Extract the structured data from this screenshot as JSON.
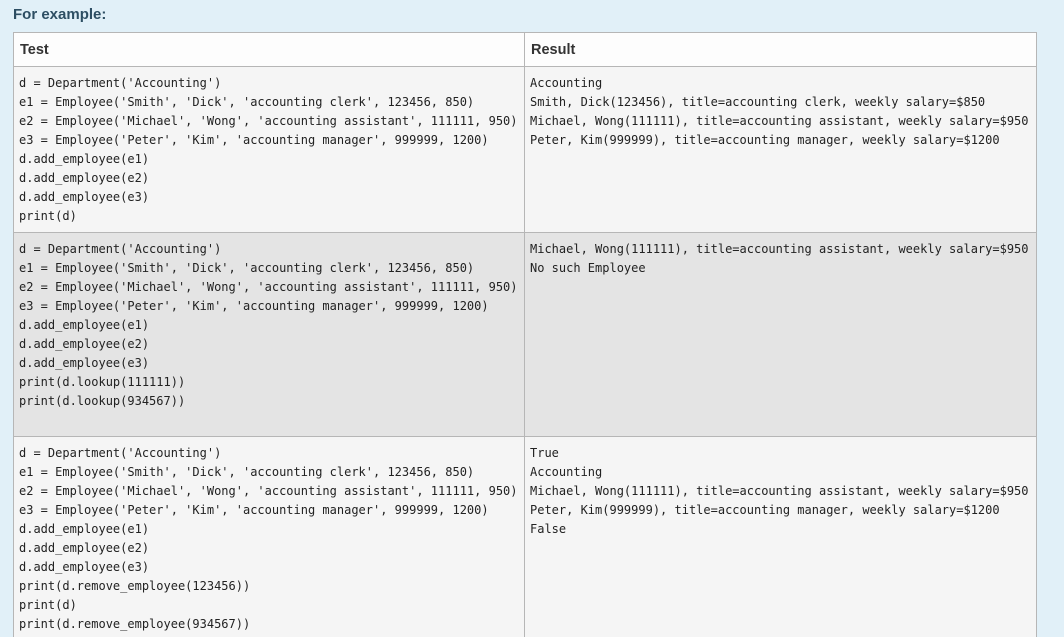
{
  "heading": "For example:",
  "table": {
    "headers": {
      "test": "Test",
      "result": "Result"
    },
    "rows": [
      {
        "test": [
          "d = Department('Accounting')",
          "e1 = Employee('Smith', 'Dick', 'accounting clerk', 123456, 850)",
          "e2 = Employee('Michael', 'Wong', 'accounting assistant', 111111, 950)",
          "e3 = Employee('Peter', 'Kim', 'accounting manager', 999999, 1200)",
          "d.add_employee(e1)",
          "d.add_employee(e2)",
          "d.add_employee(e3)",
          "print(d)"
        ],
        "result": [
          "Accounting",
          "Smith, Dick(123456), title=accounting clerk, weekly salary=$850",
          "Michael, Wong(111111), title=accounting assistant, weekly salary=$950",
          "Peter, Kim(999999), title=accounting manager, weekly salary=$1200"
        ]
      },
      {
        "test": [
          "d = Department('Accounting')",
          "e1 = Employee('Smith', 'Dick', 'accounting clerk', 123456, 850)",
          "e2 = Employee('Michael', 'Wong', 'accounting assistant', 111111, 950)",
          "e3 = Employee('Peter', 'Kim', 'accounting manager', 999999, 1200)",
          "d.add_employee(e1)",
          "d.add_employee(e2)",
          "d.add_employee(e3)",
          "print(d.lookup(111111))",
          "print(d.lookup(934567))"
        ],
        "result": [
          "Michael, Wong(111111), title=accounting assistant, weekly salary=$950",
          "No such Employee"
        ]
      },
      {
        "test": [
          "d = Department('Accounting')",
          "e1 = Employee('Smith', 'Dick', 'accounting clerk', 123456, 850)",
          "e2 = Employee('Michael', 'Wong', 'accounting assistant', 111111, 950)",
          "e3 = Employee('Peter', 'Kim', 'accounting manager', 999999, 1200)",
          "d.add_employee(e1)",
          "d.add_employee(e2)",
          "d.add_employee(e3)",
          "print(d.remove_employee(123456))",
          "print(d)",
          "print(d.remove_employee(934567))"
        ],
        "result": [
          "True",
          "Accounting",
          "Michael, Wong(111111), title=accounting assistant, weekly salary=$950",
          "Peter, Kim(999999), title=accounting manager, weekly salary=$1200",
          "False"
        ]
      }
    ]
  }
}
